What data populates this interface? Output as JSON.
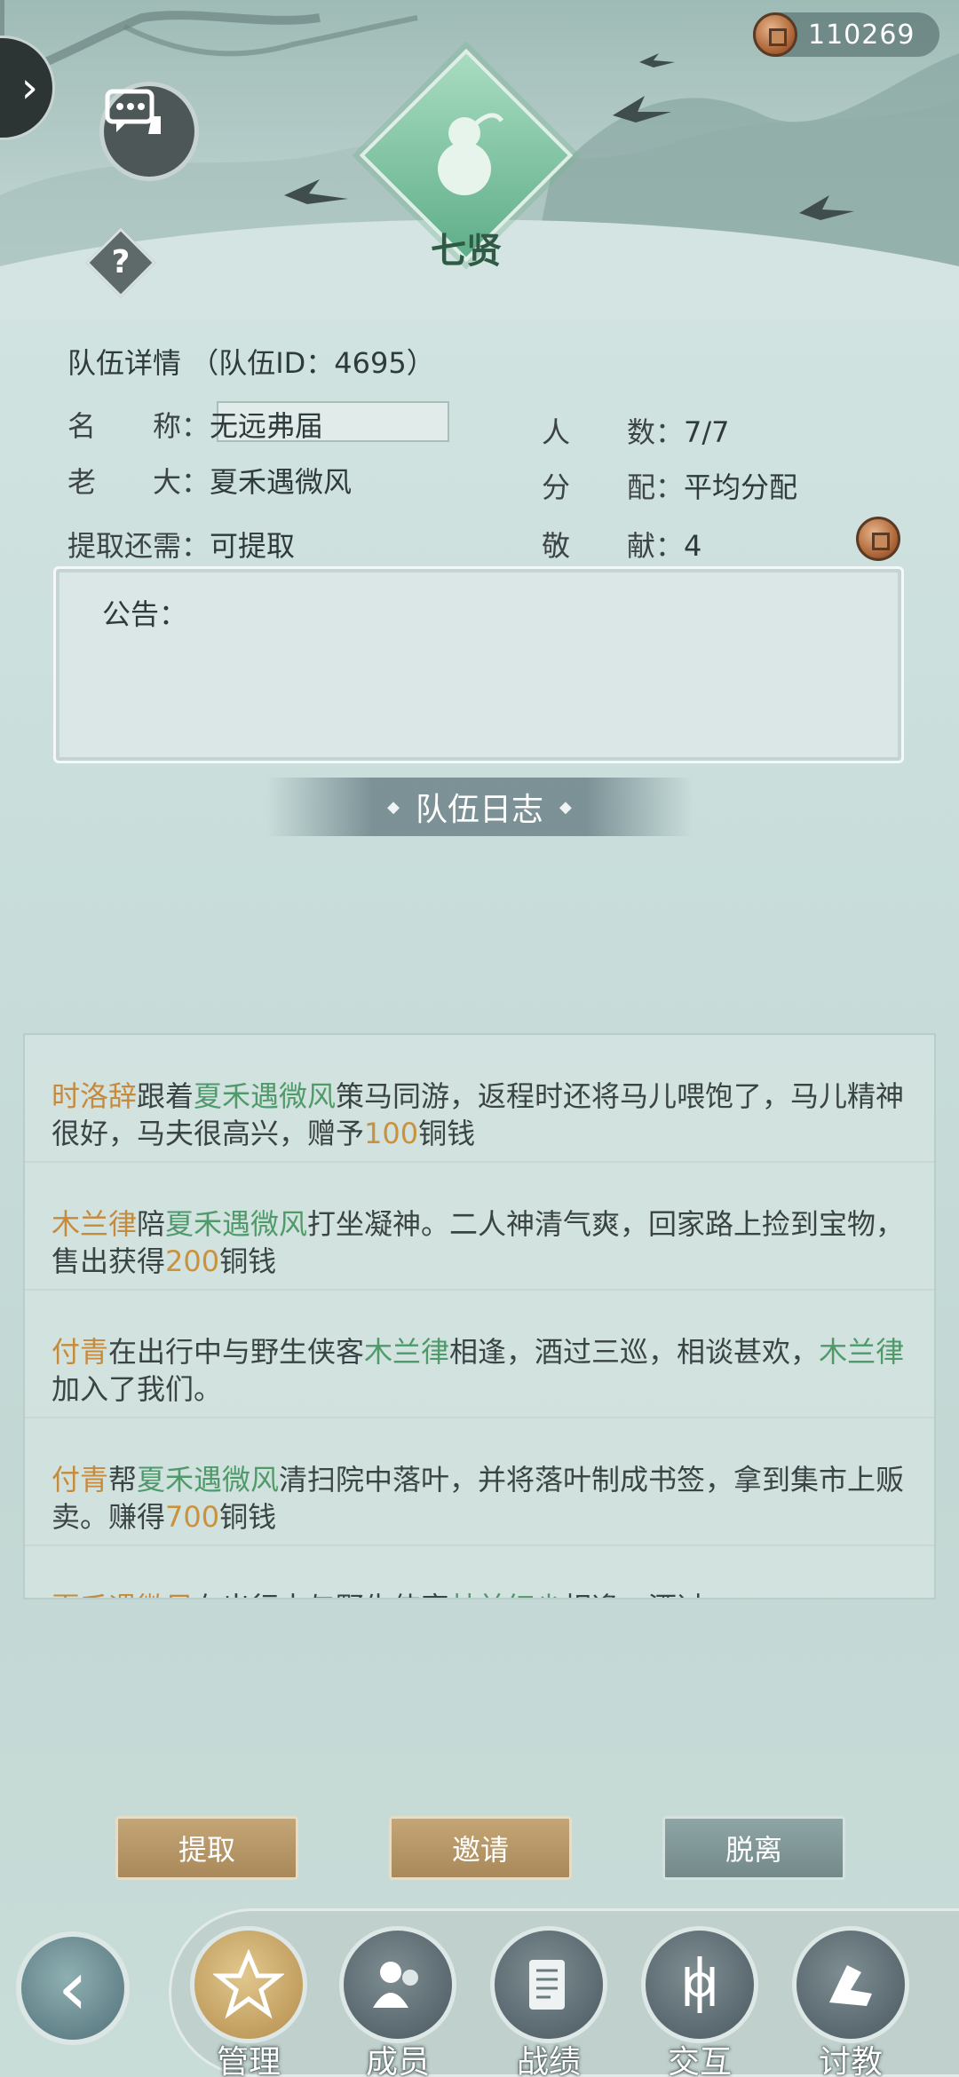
{
  "header": {
    "coin_value": "110269",
    "emblem_title": "七贤"
  },
  "team": {
    "title": "队伍详情",
    "id_text": "（队伍ID：4695）",
    "name_label": "名　　称：",
    "name_value": "无远弗届",
    "members_label": "人　　数：",
    "members_value": "7/7",
    "leader_label": "老　　大：",
    "leader_value": "夏禾遇微风",
    "distribution_label": "分　　配：",
    "distribution_value": "平均分配",
    "withdraw_label": "提取还需：",
    "withdraw_value": "可提取",
    "contribution_label": "敬　　献：",
    "contribution_value": "4"
  },
  "notice": {
    "label": "公告："
  },
  "log": {
    "title": "队伍日志",
    "entries": [
      {
        "p1": "时洛辞",
        "p2": "跟着",
        "p3": "夏禾遇微风",
        "p4": "策马同游，返程时还将马儿喂饱了，马儿精神很好，马夫很高兴，赠予",
        "p5": "100",
        "p6": "铜钱"
      },
      {
        "p1": "木兰律",
        "p2": "陪",
        "p3": "夏禾遇微风",
        "p4": "打坐凝神。二人神清气爽，回家路上捡到宝物，售出获得",
        "p5": "200",
        "p6": "铜钱"
      },
      {
        "p1": "付青",
        "p2": "在出行中与野生侠客",
        "p3": "木兰律",
        "p4": "相逢，酒过三巡，相谈甚欢，",
        "p5": "木兰律",
        "p6": "加入了我们。"
      },
      {
        "p1": "付青",
        "p2": "帮",
        "p3": "夏禾遇微风",
        "p4": "清扫院中落叶，并将落叶制成书签，拿到集市上贩卖。赚得",
        "p5": "700",
        "p6": "铜钱"
      },
      {
        "p1": "夏禾遇微风",
        "p2": "在出行中与野生侠客",
        "p3": "林前红尘",
        "p4": "相逢，酒过",
        "p5": "",
        "p6": ""
      }
    ]
  },
  "actions": {
    "withdraw": "提取",
    "invite": "邀请",
    "leave": "脱离"
  },
  "nav": {
    "manage": "管理",
    "members": "成员",
    "records": "战绩",
    "interact": "交互",
    "learn": "讨教"
  }
}
